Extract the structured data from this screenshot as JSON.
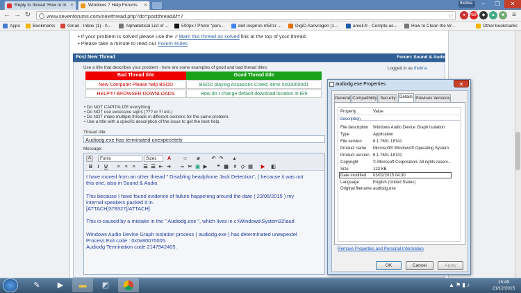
{
  "browser": {
    "tabs": [
      {
        "label": "Reply to thread 'How to m",
        "favicon_color": "#d33"
      },
      {
        "label": "Windows 7 Help Forums",
        "favicon_color": "#e89a1e"
      }
    ],
    "profile": "thelma",
    "url": "www.sevenforums.com/newthread.php?do=postthread&f=7"
  },
  "bookmarks": [
    {
      "label": "Apps",
      "icon_color": "#4a7bd1"
    },
    {
      "label": "Bookmarks",
      "icon_color": "#f4b400"
    },
    {
      "label": "Gmail - Inbox (1) - h...",
      "icon_color": "#d44638"
    },
    {
      "label": "Alphabetical List of ...",
      "icon_color": "#777"
    },
    {
      "label": "500px / Photo \"pers...",
      "icon_color": "#111"
    },
    {
      "label": "dell inspiron m501r ...",
      "icon_color": "#4285f4"
    },
    {
      "label": "DigiD Aanvragen (1...",
      "icon_color": "#e17000"
    },
    {
      "label": "ameli.fr - Compte as...",
      "icon_color": "#1e5aa8"
    },
    {
      "label": "How to Clean the W...",
      "icon_color": "#777"
    },
    {
      "label": "Other bookmarks",
      "icon_color": "#f4b400"
    }
  ],
  "notes": {
    "line1_prefix": "If your problem is solved please use the",
    "line1_link": "Mark this thread as solved",
    "line1_suffix": "link at the top of your thread.",
    "line2_prefix": "Please take a minute to read our",
    "line2_link": "Forum Rules"
  },
  "post": {
    "header": "Post New Thread",
    "forum": "Forum: Sound & Audio",
    "intro": "Use a title that describes your problem - here are some examples of good and bad thread titles:",
    "logged_in": "Logged in as",
    "user": "thelma",
    "bad_header": "Bad Thread title",
    "good_header": "Good Thread title",
    "examples": [
      {
        "bad": "New Computer Please help BSOD",
        "good": "BSOD playing Assassins Creed, error 0x000000d1"
      },
      {
        "bad": "HELP!!!! BROWSER DOWNLOADS",
        "good": "How do I change default download location in IE9"
      }
    ],
    "rules": [
      "Do NOT CAPITALIZE everything.",
      "Do NOT use excessive signs (??? or !!! etc.)",
      "Do NOT make multiple threads in different sections for the same problem.",
      "Use a title with a specific description of the issue to get the best help."
    ],
    "title_label": "Thread title:",
    "title_value": "Audiodg.exe has terminated unexpecetely",
    "message_label": "Message:",
    "font_select": "Fonts",
    "size_select": "Sizes",
    "message_lines": [
      "I have moved from an other thread \" Disabling headphone Jack Detection\", ( because it was not",
      "this one, also in Sound & Audio.",
      "",
      "This because I have found evidence of failure happening around the date ( 23/05/2015 ) my",
      "internal speakers packed it in.",
      "[ATTACH]378327[/ATTACH]",
      "",
      "This is caused by a mistake in the \" Audiodg.exe \", which lives in c:\\Windows\\System32\\aud",
      "",
      "Windows Audio Device Graph Isolation process ( audiodg.exe ) has determinated unexpextel",
      "Process Exit code : 0x0x80070005.",
      "Audiodg Termination code 2147942405."
    ]
  },
  "dialog": {
    "title": "audiodg.exe Properties",
    "tabs": [
      "General",
      "Compatibility",
      "Security",
      "Details",
      "Previous Versions"
    ],
    "col_property": "Property",
    "col_value": "Value",
    "section": "Description",
    "rows": [
      {
        "property": "File description",
        "value": "Windows Audio Device Graph Isolation"
      },
      {
        "property": "Type",
        "value": "Application"
      },
      {
        "property": "File version",
        "value": "6.1.7601.18741"
      },
      {
        "property": "Product name",
        "value": "Microsoft® Windows® Operating System"
      },
      {
        "property": "Product version",
        "value": "6.1.7601.18741"
      },
      {
        "property": "Copyright",
        "value": "© Microsoft Corporation. All rights reserv..."
      },
      {
        "property": "Size",
        "value": "123 KB"
      },
      {
        "property": "Date modified",
        "value": "03/02/2015 04:30"
      },
      {
        "property": "Language",
        "value": "English (United States)"
      },
      {
        "property": "Original filename",
        "value": "audiodg.exe"
      }
    ],
    "remove_link": "Remove Properties and Personal Information",
    "ok": "OK",
    "cancel": "Cancel",
    "apply": "Apply"
  },
  "taskbar": {
    "time": "15:49",
    "date": "21/12/2015"
  }
}
